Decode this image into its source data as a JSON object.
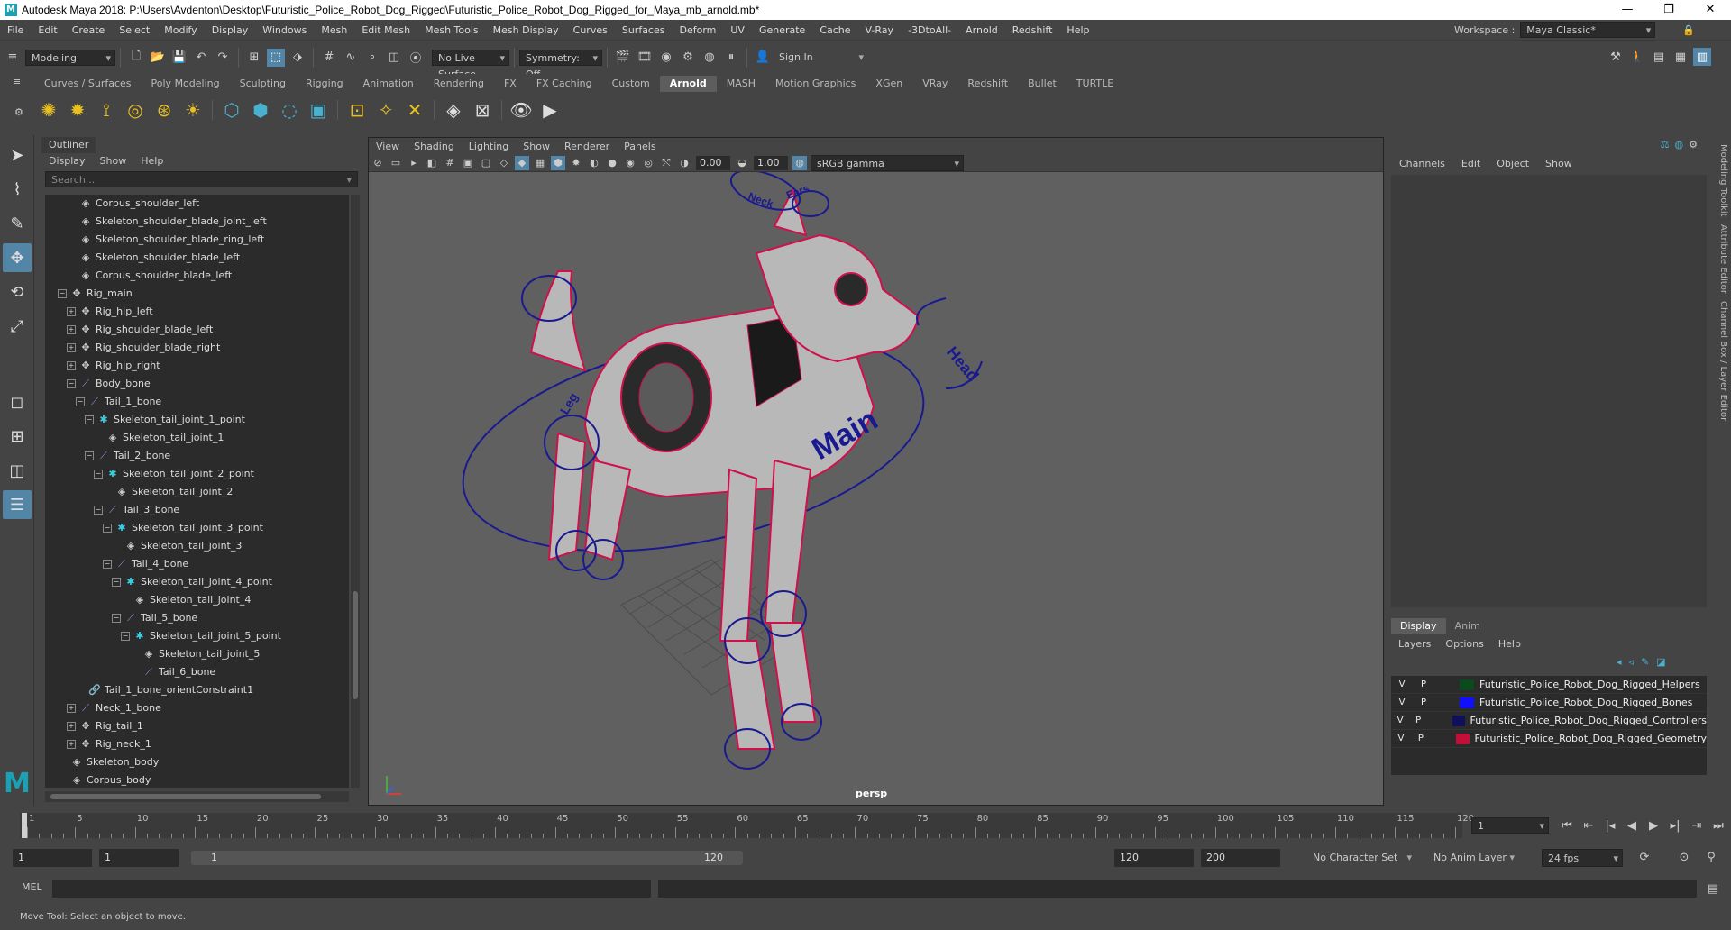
{
  "title": "Autodesk Maya 2018: P:\\Users\\Avdenton\\Desktop\\Futuristic_Police_Robot_Dog_Rigged\\Futuristic_Police_Robot_Dog_Rigged_for_Maya_mb_arnold.mb*",
  "menus": [
    "File",
    "Edit",
    "Create",
    "Select",
    "Modify",
    "Display",
    "Windows",
    "Mesh",
    "Edit Mesh",
    "Mesh Tools",
    "Mesh Display",
    "Curves",
    "Surfaces",
    "Deform",
    "UV",
    "Generate",
    "Cache",
    "V-Ray",
    "-3DtoAll-",
    "Arnold",
    "Redshift",
    "Help"
  ],
  "workspace": {
    "label": "Workspace :",
    "value": "Maya Classic*"
  },
  "status": {
    "mode": "Modeling",
    "live_surface": "No Live Surface",
    "symmetry": "Symmetry: Off",
    "sign_in": "Sign In"
  },
  "shelf_tabs": [
    "Curves / Surfaces",
    "Poly Modeling",
    "Sculpting",
    "Rigging",
    "Animation",
    "Rendering",
    "FX",
    "FX Caching",
    "Custom",
    "Arnold",
    "MASH",
    "Motion Graphics",
    "XGen",
    "VRay",
    "Redshift",
    "Bullet",
    "TURTLE"
  ],
  "active_shelf": "Arnold",
  "outliner": {
    "title": "Outliner",
    "menu": [
      "Display",
      "Show",
      "Help"
    ],
    "search_placeholder": "Search...",
    "rows": [
      {
        "t": "Corpus_shoulder_left",
        "d": 1,
        "ic": "mesh",
        "ex": ""
      },
      {
        "t": "Skeleton_shoulder_blade_joint_left",
        "d": 1,
        "ic": "mesh",
        "ex": ""
      },
      {
        "t": "Skeleton_shoulder_blade_ring_left",
        "d": 1,
        "ic": "mesh",
        "ex": ""
      },
      {
        "t": "Skeleton_shoulder_blade_left",
        "d": 1,
        "ic": "mesh",
        "ex": ""
      },
      {
        "t": "Corpus_shoulder_blade_left",
        "d": 1,
        "ic": "mesh",
        "ex": ""
      },
      {
        "t": "Rig_main",
        "d": 0,
        "ic": "tr",
        "ex": "-"
      },
      {
        "t": "Rig_hip_left",
        "d": 1,
        "ic": "tr",
        "ex": "+"
      },
      {
        "t": "Rig_shoulder_blade_left",
        "d": 1,
        "ic": "tr",
        "ex": "+"
      },
      {
        "t": "Rig_shoulder_blade_right",
        "d": 1,
        "ic": "tr",
        "ex": "+"
      },
      {
        "t": "Rig_hip_right",
        "d": 1,
        "ic": "tr",
        "ex": "+"
      },
      {
        "t": "Body_bone",
        "d": 1,
        "ic": "bone",
        "ex": "-"
      },
      {
        "t": "Tail_1_bone",
        "d": 2,
        "ic": "bone",
        "ex": "-"
      },
      {
        "t": "Skeleton_tail_joint_1_point",
        "d": 3,
        "ic": "pt",
        "ex": "-"
      },
      {
        "t": "Skeleton_tail_joint_1",
        "d": 4,
        "ic": "mesh",
        "ex": ""
      },
      {
        "t": "Tail_2_bone",
        "d": 3,
        "ic": "bone",
        "ex": "-"
      },
      {
        "t": "Skeleton_tail_joint_2_point",
        "d": 4,
        "ic": "pt",
        "ex": "-"
      },
      {
        "t": "Skeleton_tail_joint_2",
        "d": 5,
        "ic": "mesh",
        "ex": ""
      },
      {
        "t": "Tail_3_bone",
        "d": 4,
        "ic": "bone",
        "ex": "-"
      },
      {
        "t": "Skeleton_tail_joint_3_point",
        "d": 5,
        "ic": "pt",
        "ex": "-"
      },
      {
        "t": "Skeleton_tail_joint_3",
        "d": 6,
        "ic": "mesh",
        "ex": ""
      },
      {
        "t": "Tail_4_bone",
        "d": 5,
        "ic": "bone",
        "ex": "-"
      },
      {
        "t": "Skeleton_tail_joint_4_point",
        "d": 6,
        "ic": "pt",
        "ex": "-"
      },
      {
        "t": "Skeleton_tail_joint_4",
        "d": 7,
        "ic": "mesh",
        "ex": ""
      },
      {
        "t": "Tail_5_bone",
        "d": 6,
        "ic": "bone",
        "ex": "-"
      },
      {
        "t": "Skeleton_tail_joint_5_point",
        "d": 7,
        "ic": "pt",
        "ex": "-"
      },
      {
        "t": "Skeleton_tail_joint_5",
        "d": 8,
        "ic": "mesh",
        "ex": ""
      },
      {
        "t": "Tail_6_bone",
        "d": 8,
        "ic": "bone",
        "ex": ""
      },
      {
        "t": "Tail_1_bone_orientConstraint1",
        "d": 2,
        "ic": "cn",
        "ex": ""
      },
      {
        "t": "Neck_1_bone",
        "d": 1,
        "ic": "bone",
        "ex": "+"
      },
      {
        "t": "Rig_tail_1",
        "d": 1,
        "ic": "tr",
        "ex": "+"
      },
      {
        "t": "Rig_neck_1",
        "d": 1,
        "ic": "tr",
        "ex": "+"
      },
      {
        "t": "Skeleton_body",
        "d": 0,
        "ic": "mesh",
        "ex": ""
      },
      {
        "t": "Corpus_body",
        "d": 0,
        "ic": "mesh",
        "ex": ""
      }
    ]
  },
  "viewport": {
    "menu": [
      "View",
      "Shading",
      "Lighting",
      "Show",
      "Renderer",
      "Panels"
    ],
    "exposure": "0.00",
    "gamma": "1.00",
    "colorspace": "sRGB gamma",
    "camera": "persp",
    "rig_labels": {
      "neck": "Neck",
      "ears": "Ears",
      "head": "Head",
      "main": "Main",
      "leg": "Leg"
    }
  },
  "channelbox": {
    "menu": [
      "Channels",
      "Edit",
      "Object",
      "Show"
    ],
    "tabs": [
      "Display",
      "Anim"
    ],
    "active_tab": "Display",
    "layer_menu": [
      "Layers",
      "Options",
      "Help"
    ],
    "layers": [
      {
        "v": "V",
        "p": "P",
        "color": "#0c4a1e",
        "name": "Futuristic_Police_Robot_Dog_Rigged_Helpers"
      },
      {
        "v": "V",
        "p": "P",
        "color": "#1010ff",
        "name": "Futuristic_Police_Robot_Dog_Rigged_Bones"
      },
      {
        "v": "V",
        "p": "P",
        "color": "#10105a",
        "name": "Futuristic_Police_Robot_Dog_Rigged_Controllers"
      },
      {
        "v": "V",
        "p": "P",
        "color": "#c0103a",
        "name": "Futuristic_Police_Robot_Dog_Rigged_Geometry"
      }
    ],
    "side_tabs": [
      "Modeling Toolkit",
      "Attribute Editor",
      "Channel Box / Layer Editor"
    ]
  },
  "timeline": {
    "ticks": [
      "1",
      "5",
      "10",
      "15",
      "20",
      "25",
      "30",
      "35",
      "40",
      "45",
      "50",
      "55",
      "60",
      "65",
      "70",
      "75",
      "80",
      "85",
      "90",
      "95",
      "100",
      "105",
      "110",
      "115",
      "120"
    ],
    "tick_values": [
      1,
      5,
      10,
      15,
      20,
      25,
      30,
      35,
      40,
      45,
      50,
      55,
      60,
      65,
      70,
      75,
      80,
      85,
      90,
      95,
      100,
      105,
      110,
      115,
      120
    ],
    "min": 1,
    "max": 120,
    "current_frame": "1"
  },
  "range": {
    "start": "1",
    "playback_start": "1",
    "slider_start": "1",
    "slider_end": "120",
    "playback_end": "120",
    "end": "200",
    "character_set": "No Character Set",
    "anim_layer": "No Anim Layer",
    "fps": "24 fps"
  },
  "cmd": {
    "label": "MEL"
  },
  "help_line": "Move Tool: Select an object to move."
}
